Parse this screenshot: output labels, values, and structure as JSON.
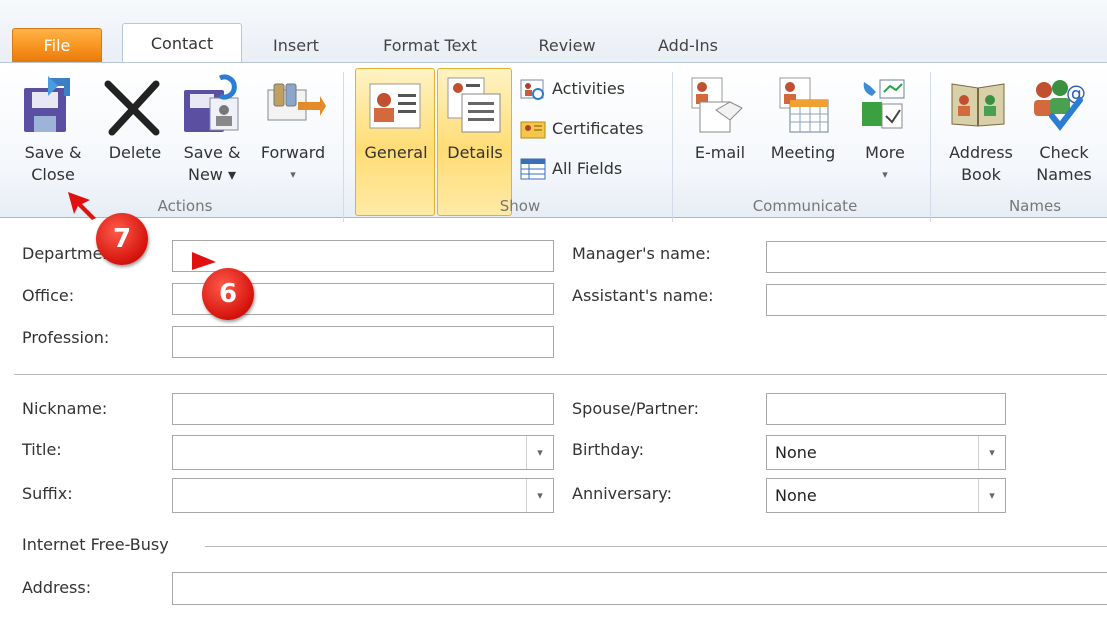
{
  "tabs": {
    "file": "File",
    "contact": "Contact",
    "insert": "Insert",
    "format_text": "Format Text",
    "review": "Review",
    "add_ins": "Add-Ins"
  },
  "ribbon": {
    "actions": {
      "label": "Actions",
      "save_close": [
        "Save &",
        "Close"
      ],
      "delete": "Delete",
      "save_new": [
        "Save &",
        "New ▾"
      ],
      "forward": [
        "Forward",
        "▾"
      ]
    },
    "show": {
      "label": "Show",
      "general": "General",
      "details": "Details",
      "activities": "Activities",
      "certificates": "Certificates",
      "all_fields": "All Fields"
    },
    "communicate": {
      "label": "Communicate",
      "email": "E-mail",
      "meeting": "Meeting",
      "more": [
        "More",
        "▾"
      ]
    },
    "names": {
      "label": "Names",
      "address_book": [
        "Address",
        "Book"
      ],
      "check_names": [
        "Check",
        "Names"
      ]
    }
  },
  "form": {
    "department": "Department:",
    "office": "Office:",
    "profession": "Profession:",
    "manager": "Manager's name:",
    "assistant": "Assistant's name:",
    "nickname": "Nickname:",
    "title": "Title:",
    "suffix": "Suffix:",
    "spouse": "Spouse/Partner:",
    "birthday": "Birthday:",
    "birthday_value": "None",
    "anniversary": "Anniversary:",
    "anniversary_value": "None",
    "internet_free_busy": "Internet Free-Busy",
    "address": "Address:"
  },
  "callouts": {
    "seven": "7",
    "six": "6"
  },
  "colors": {
    "file_tab": "#f7921e",
    "highlight": "#ffdc75",
    "callout_red": "#d4130c"
  }
}
